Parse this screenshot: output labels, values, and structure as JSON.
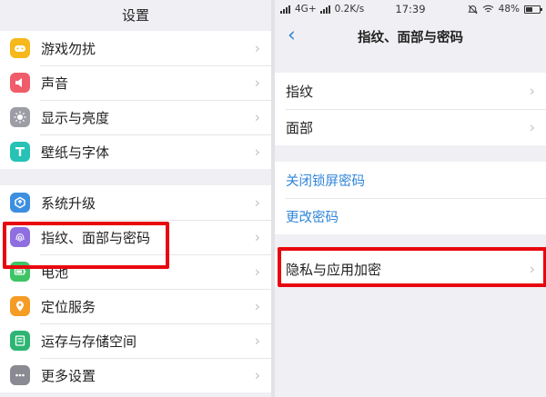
{
  "left": {
    "title": "设置",
    "groups": [
      [
        {
          "label": "游戏勿扰",
          "icon": "game-controller-icon",
          "color": "#f6b81b"
        },
        {
          "label": "声音",
          "icon": "speaker-icon",
          "color": "#f05d6a"
        },
        {
          "label": "显示与亮度",
          "icon": "brightness-icon",
          "color": "#9d9da6"
        },
        {
          "label": "壁纸与字体",
          "icon": "font-t-icon",
          "color": "#25c2b5"
        }
      ],
      [
        {
          "label": "系统升级",
          "icon": "update-icon",
          "color": "#3c8fe0"
        },
        {
          "label": "指纹、面部与密码",
          "icon": "fingerprint-icon",
          "color": "#8f6fe0"
        },
        {
          "label": "电池",
          "icon": "battery-icon",
          "color": "#3ec465"
        },
        {
          "label": "定位服务",
          "icon": "location-pin-icon",
          "color": "#f59c25"
        },
        {
          "label": "运存与存储空间",
          "icon": "storage-icon",
          "color": "#2cb573"
        },
        {
          "label": "更多设置",
          "icon": "more-settings-icon",
          "color": "#8a8a92"
        }
      ]
    ]
  },
  "right": {
    "status": {
      "signal": "4G+",
      "speed": "0.2K/s",
      "time": "17:39",
      "battery": "48%",
      "battery_level": 0.48
    },
    "title": "指纹、面部与密码",
    "group1": [
      "指纹",
      "面部"
    ],
    "group2": [
      "关闭锁屏密码",
      "更改密码"
    ],
    "group3": [
      "隐私与应用加密"
    ]
  },
  "colors": {
    "accent": "#2f84d9",
    "highlight": "#e8070e"
  }
}
